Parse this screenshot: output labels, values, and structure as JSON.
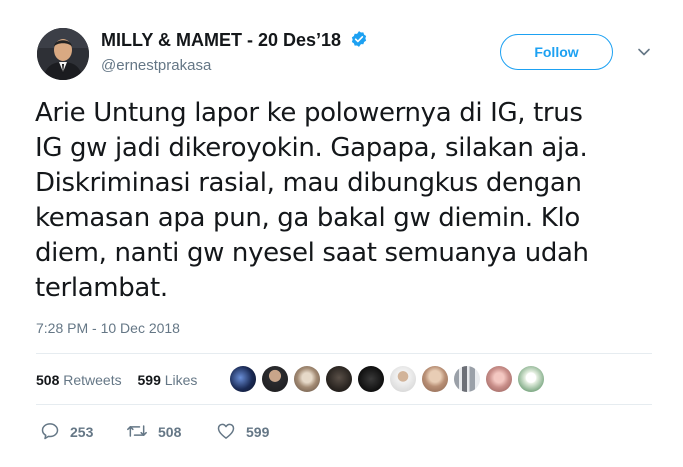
{
  "author": {
    "display_name": "MILLY & MAMET - 20 Des’18",
    "handle": "@ernestprakasa",
    "verified": true
  },
  "follow_button": {
    "label": "Follow"
  },
  "tweet": {
    "text_lines": [
      "Arie Untung lapor ke polowernya di IG, trus",
      "IG gw jadi dikeroyokin. Gapapa, silakan aja.",
      "Diskriminasi rasial, mau dibungkus dengan",
      "kemasan apa pun, ga bakal gw diemin. Klo",
      "diem, nanti gw nyesel saat semuanya udah",
      "terlambat."
    ],
    "timestamp": "7:28 PM - 10 Dec 2018"
  },
  "stats": {
    "retweets_count": "508",
    "retweets_label": "Retweets",
    "likes_count": "599",
    "likes_label": "Likes"
  },
  "actions": {
    "reply_count": "253",
    "retweet_count": "508",
    "like_count": "599"
  },
  "colors": {
    "accent": "#1da1f2",
    "text": "#14171a",
    "muted": "#657786",
    "divider": "#e6ecf0"
  }
}
